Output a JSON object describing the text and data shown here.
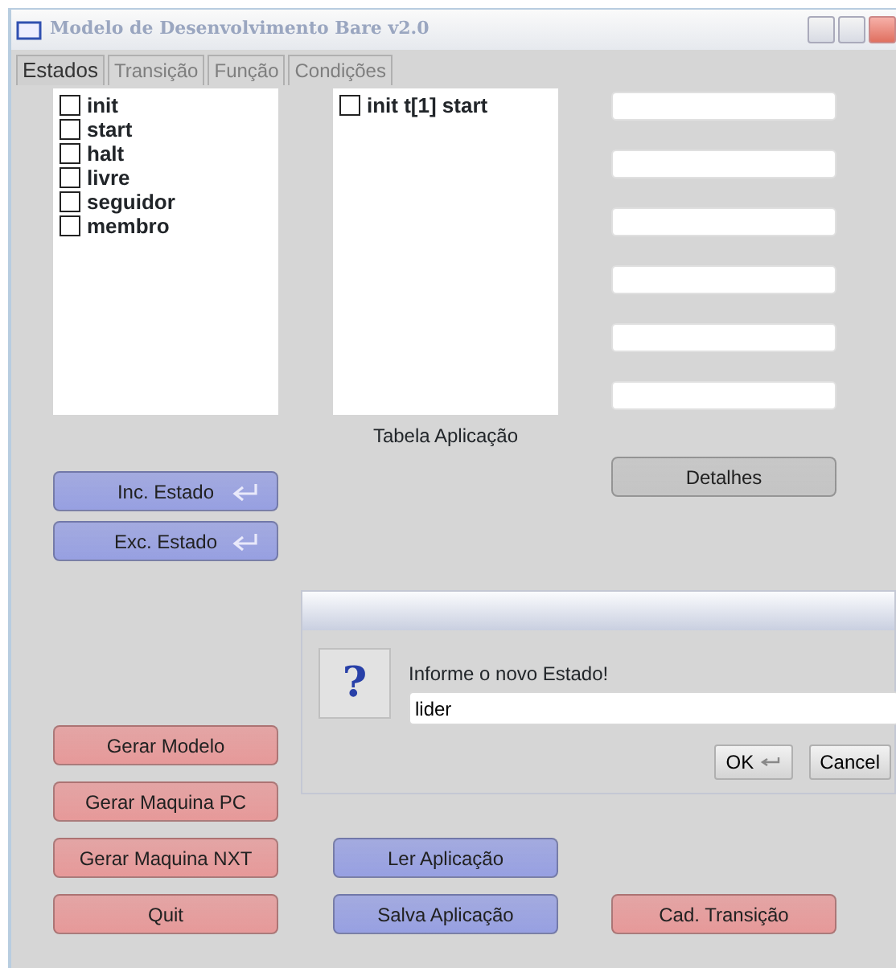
{
  "window": {
    "title": "Modelo de Desenvolvimento Bare v2.0"
  },
  "tabs": [
    {
      "label": "Estados",
      "selected": true,
      "disabled": false
    },
    {
      "label": "Transição",
      "selected": false,
      "disabled": true
    },
    {
      "label": "Função",
      "selected": false,
      "disabled": true
    },
    {
      "label": "Condições",
      "selected": false,
      "disabled": true
    }
  ],
  "states_list": [
    {
      "label": "init",
      "checked": false
    },
    {
      "label": "start",
      "checked": false
    },
    {
      "label": "halt",
      "checked": false
    },
    {
      "label": "livre",
      "checked": false
    },
    {
      "label": "seguidor",
      "checked": false
    },
    {
      "label": "membro",
      "checked": false
    }
  ],
  "application_table": {
    "items": [
      {
        "label": "init t[1] start",
        "checked": false
      }
    ],
    "caption": "Tabela Aplicação"
  },
  "buttons": [
    {
      "label": "Inc. Estado",
      "kind": "enter",
      "color": "#9aa3e6"
    },
    {
      "label": "Exc. Estado",
      "kind": "enter",
      "color": "#9aa3e6"
    },
    {
      "label": "Detalhes",
      "kind": "plain",
      "color": "#c8c8c8"
    },
    {
      "label": "Gerar Modelo",
      "kind": "plain",
      "color": "#eb9c9c"
    },
    {
      "label": "Gerar Maquina PC",
      "kind": "plain",
      "color": "#eb9c9c"
    },
    {
      "label": "Gerar Maquina NXT",
      "kind": "plain",
      "color": "#eb9c9c"
    },
    {
      "label": "Ler Aplicação",
      "kind": "plain",
      "color": "#9aa3e6"
    },
    {
      "label": "Quit",
      "kind": "plain",
      "color": "#eb9c9c"
    },
    {
      "label": "Salva Aplicação",
      "kind": "plain",
      "color": "#9aa3e6"
    },
    {
      "label": "Cad. Transição",
      "kind": "plain",
      "color": "#eb9c9c"
    }
  ],
  "dialog": {
    "icon": "?",
    "message": "Informe o novo Estado!",
    "value": "lider",
    "buttons": [
      {
        "label": "OK",
        "kind": "enter"
      },
      {
        "label": "Cancel",
        "kind": "plain"
      }
    ]
  }
}
